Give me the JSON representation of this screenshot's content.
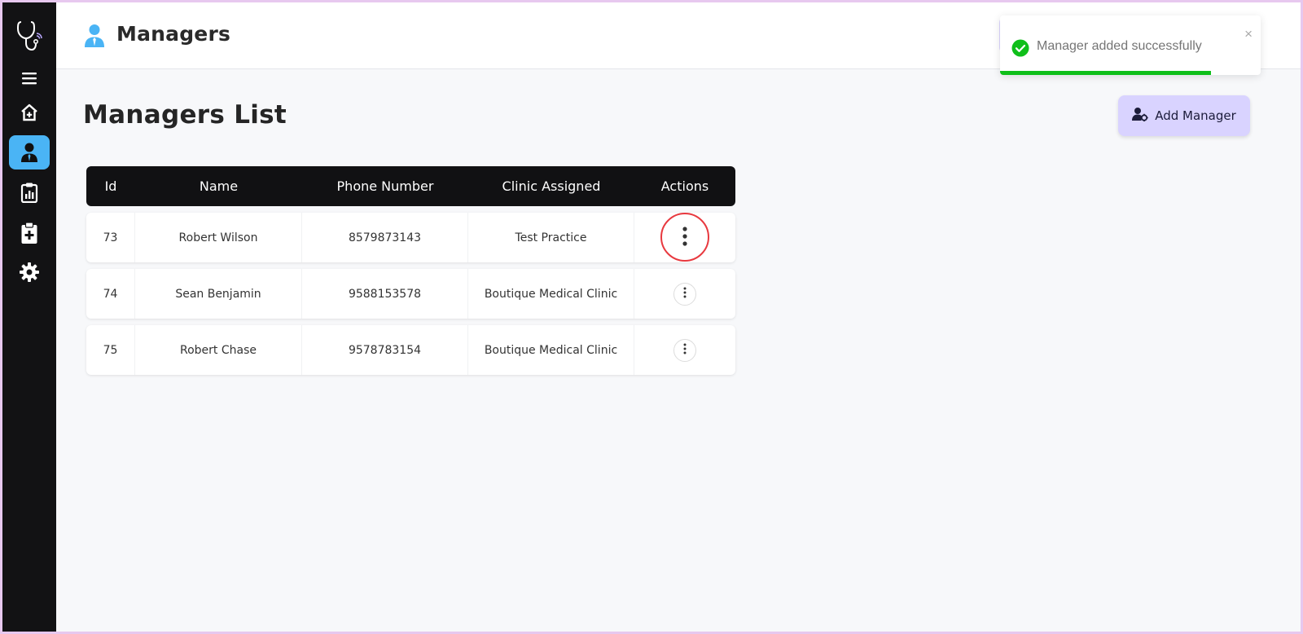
{
  "header": {
    "title": "Managers"
  },
  "toast": {
    "message": "Manager added successfully",
    "close_symbol": "×",
    "progress": 0.81,
    "color": "#0fbf1a"
  },
  "main": {
    "heading": "Managers List",
    "add_button_label": "Add Manager"
  },
  "table": {
    "columns": [
      "Id",
      "Name",
      "Phone Number",
      "Clinic Assigned",
      "Actions"
    ],
    "rows": [
      {
        "id": "73",
        "name": "Robert Wilson",
        "phone": "8579873143",
        "clinic": "Test Practice"
      },
      {
        "id": "74",
        "name": "Sean Benjamin",
        "phone": "9588153578",
        "clinic": "Boutique Medical Clinic"
      },
      {
        "id": "75",
        "name": "Robert Chase",
        "phone": "9578783154",
        "clinic": "Boutique Medical Clinic"
      }
    ]
  },
  "sidebar": {
    "items": [
      {
        "icon": "stethoscope-logo-icon"
      },
      {
        "icon": "hamburger-menu-icon"
      },
      {
        "icon": "home-icon"
      },
      {
        "icon": "manager-user-icon",
        "active": true
      },
      {
        "icon": "clipboard-report-icon"
      },
      {
        "icon": "medical-clipboard-icon"
      },
      {
        "icon": "settings-gear-icon"
      }
    ],
    "active_color": "#4ab4f5"
  }
}
